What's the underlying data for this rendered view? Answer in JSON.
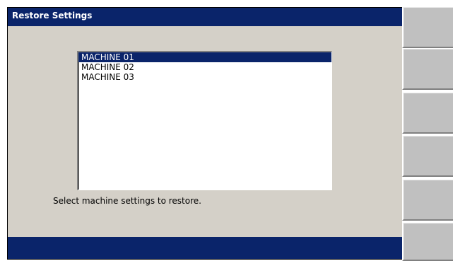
{
  "dialog": {
    "title": "Restore Settings",
    "status_text": "Select machine settings to restore."
  },
  "machine_list": {
    "items": [
      {
        "label": "MACHINE 01",
        "selected": true
      },
      {
        "label": "MACHINE 02",
        "selected": false
      },
      {
        "label": "MACHINE 03",
        "selected": false
      }
    ]
  },
  "softkeys": [
    {
      "label": ""
    },
    {
      "label": ""
    },
    {
      "label": ""
    },
    {
      "label": ""
    },
    {
      "label": ""
    },
    {
      "label": ""
    }
  ],
  "colors": {
    "titlebar": "#0a246a",
    "selection": "#0a246a",
    "dialog_background": "#d4d0c8",
    "softkey_background": "#c0c0c0"
  }
}
